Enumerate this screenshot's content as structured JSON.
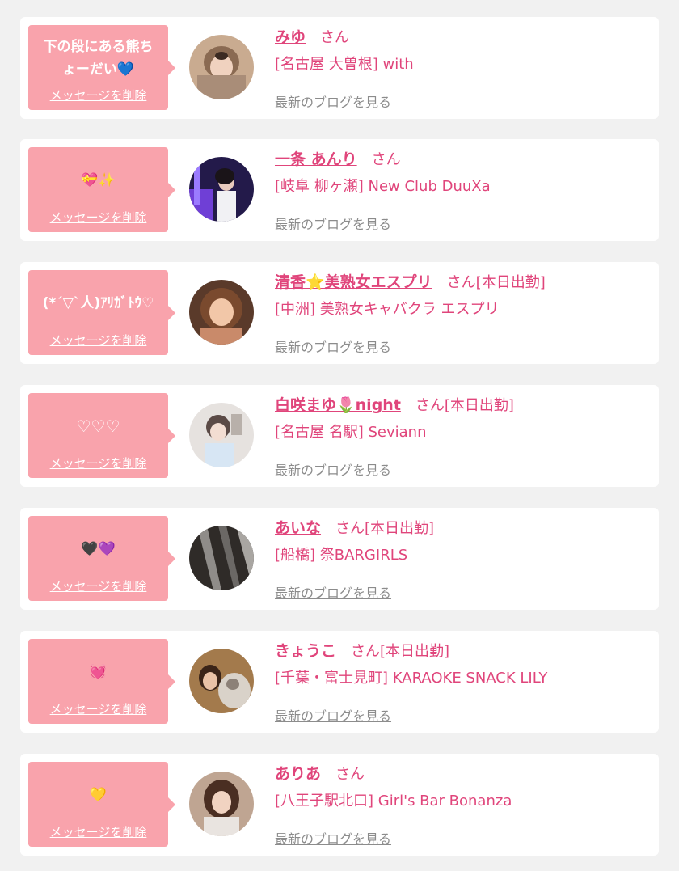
{
  "common": {
    "delete_label": "メッセージを削除",
    "blog_label": "最新のブログを見る"
  },
  "cards": [
    {
      "message": "下の段にある熊ち\nょーだい💙",
      "name": "みゆ",
      "suffix": "さん",
      "shop": "[名古屋 大曽根] with"
    },
    {
      "message": "💝✨",
      "name": "一条 あんり",
      "suffix": "さん",
      "shop": "[岐阜 柳ヶ瀬] New Club DuuXa"
    },
    {
      "message": "(*´▽`人)ｱﾘｶﾞﾄｳ♡",
      "name": "清香⭐美熟女エスプリ",
      "suffix": "さん[本日出勤]",
      "shop": "[中洲] 美熟女キャバクラ エスプリ"
    },
    {
      "message": "♡♡♡",
      "name": "白咲まゆ🌷night",
      "suffix": "さん[本日出勤]",
      "shop": "[名古屋 名駅] Seviann"
    },
    {
      "message": "🖤💜",
      "name": "あいな",
      "suffix": "さん[本日出勤]",
      "shop": "[船橋] 祭BARGIRLS"
    },
    {
      "message": "💓",
      "name": "きょうこ",
      "suffix": "さん[本日出勤]",
      "shop": "[千葉・富士見町] KARAOKE SNACK LILY"
    },
    {
      "message": "💛",
      "name": "ありあ",
      "suffix": "さん",
      "shop": "[八王子駅北口] Girl's Bar Bonanza"
    }
  ]
}
